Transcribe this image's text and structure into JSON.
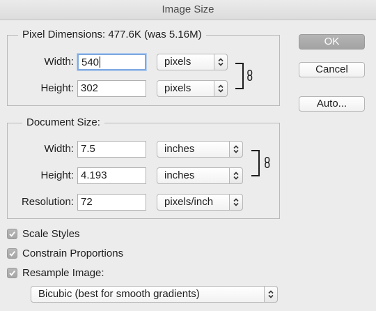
{
  "window": {
    "title": "Image Size"
  },
  "pixel_dimensions": {
    "legend": "Pixel Dimensions:  477.6K (was 5.16M)",
    "width_label": "Width:",
    "width_value": "540",
    "width_unit": "pixels",
    "height_label": "Height:",
    "height_value": "302",
    "height_unit": "pixels"
  },
  "document_size": {
    "legend": "Document Size:",
    "width_label": "Width:",
    "width_value": "7.5",
    "width_unit": "inches",
    "height_label": "Height:",
    "height_value": "4.193",
    "height_unit": "inches",
    "resolution_label": "Resolution:",
    "resolution_value": "72",
    "resolution_unit": "pixels/inch"
  },
  "buttons": {
    "ok": "OK",
    "cancel": "Cancel",
    "auto": "Auto..."
  },
  "options": {
    "scale_styles": {
      "label": "Scale Styles",
      "checked": true
    },
    "constrain_proportions": {
      "label": "Constrain Proportions",
      "checked": true
    },
    "resample_image": {
      "label": "Resample Image:",
      "checked": true
    }
  },
  "resample_method": "Bicubic (best for smooth gradients)",
  "icons": {
    "stepper": "up-down-chevron-icon",
    "link": "chain-link-icon",
    "check": "checkmark-icon"
  },
  "colors": {
    "default_button": "#a9a9a9",
    "focus_ring": "#7fa9e0",
    "background": "#ececec"
  }
}
